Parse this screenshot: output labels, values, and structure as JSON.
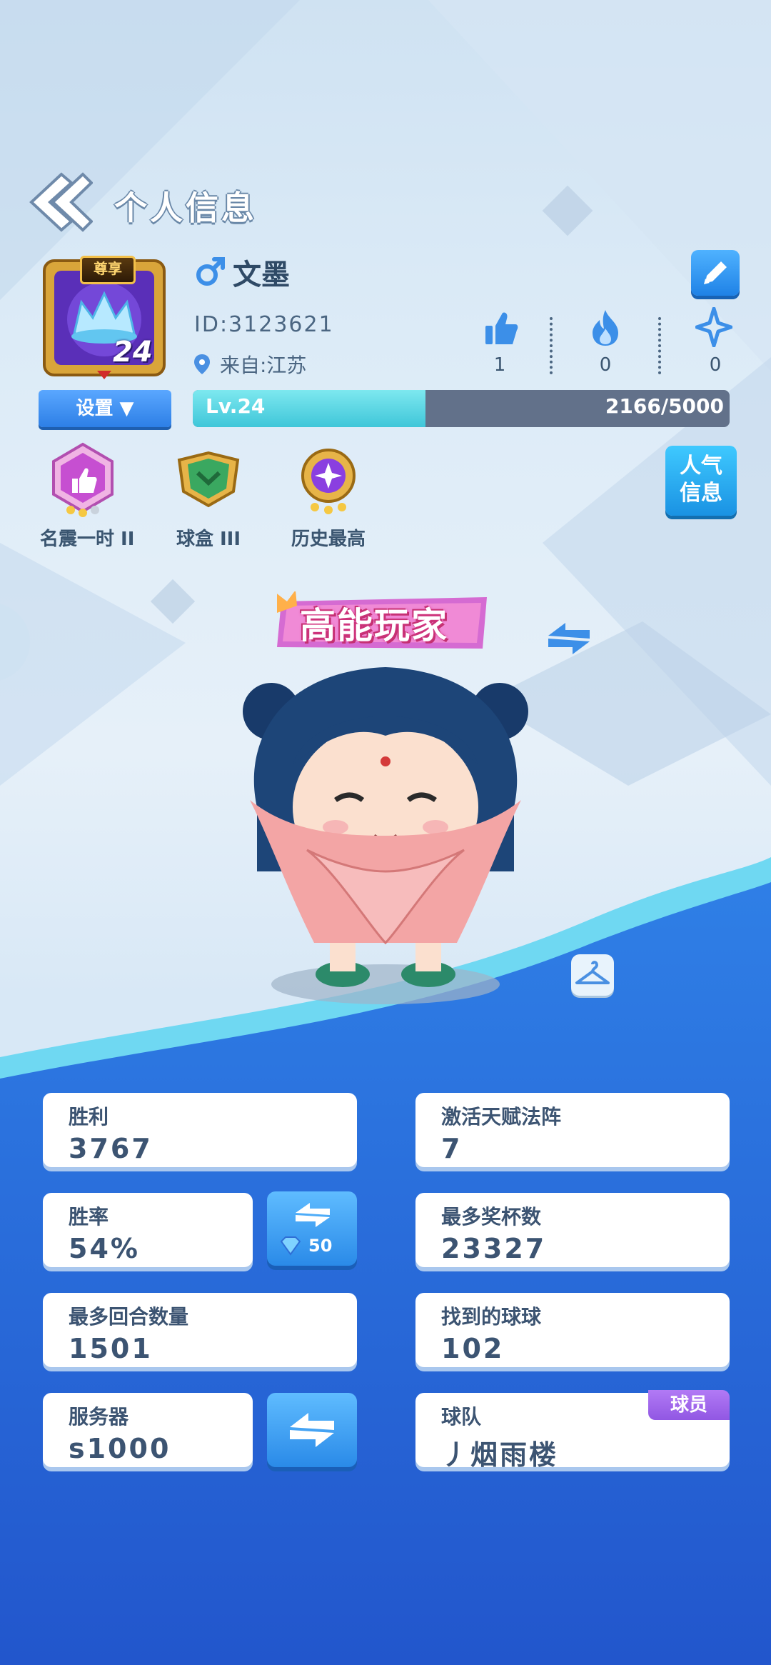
{
  "header": {
    "title": "个人信息"
  },
  "profile": {
    "vip_badge": "尊享",
    "avatar_level": "24",
    "username": "文墨",
    "user_id": "ID:3123621",
    "location": "来自:江苏",
    "stats": {
      "likes": "1",
      "fire": "0",
      "stars": "0"
    }
  },
  "settings": {
    "label": "设置 ▼"
  },
  "xp": {
    "level": "Lv.24",
    "value": "2166/5000",
    "progress": 0.433
  },
  "achievements": [
    {
      "label": "名震一时 II"
    },
    {
      "label": "球盒 III"
    },
    {
      "label": "历史最高"
    }
  ],
  "popularity_button": {
    "line1": "人气",
    "line2": "信息"
  },
  "title_banner": "高能玩家",
  "stats_cards": {
    "wins": {
      "label": "胜利",
      "value": "3767"
    },
    "talent": {
      "label": "激活天赋法阵",
      "value": "7"
    },
    "winrate": {
      "label": "胜率",
      "value": "54%"
    },
    "winrate_cost": "50",
    "trophies": {
      "label": "最多奖杯数",
      "value": "23327"
    },
    "rounds": {
      "label": "最多回合数量",
      "value": "1501"
    },
    "balls": {
      "label": "找到的球球",
      "value": "102"
    },
    "server": {
      "label": "服务器",
      "value": "s1000"
    },
    "team": {
      "label": "球队",
      "value": "丿烟雨楼",
      "role": "球员"
    }
  },
  "colors": {
    "accent": "#2a8ae8",
    "bottom_bg": "#2a68d8",
    "xp_fill": "#3fc6d9",
    "role_tag": "#9157e3"
  }
}
